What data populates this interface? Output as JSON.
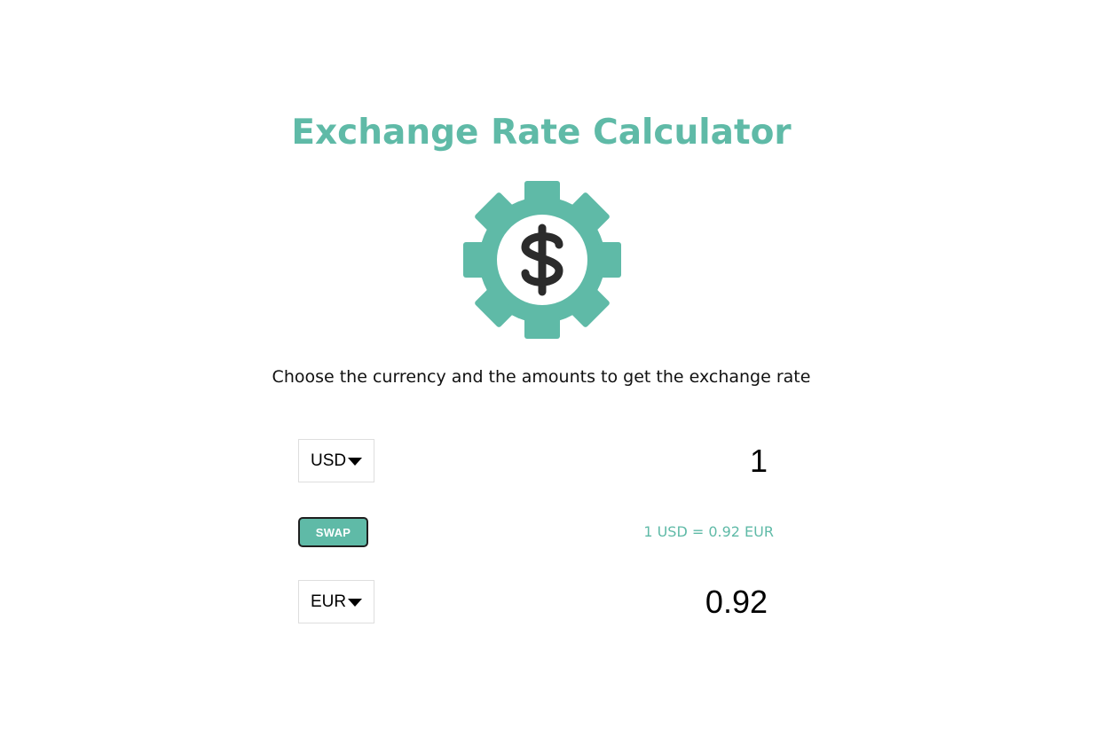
{
  "header": {
    "title": "Exchange Rate Calculator",
    "logo_icon": "gear-dollar-icon"
  },
  "instructions": "Choose the currency and the amounts to get the exchange rate",
  "currency_one": {
    "selected": "USD",
    "amount": "1"
  },
  "swap": {
    "label": "SWAP"
  },
  "rate": {
    "text": "1 USD = 0.92 EUR"
  },
  "currency_two": {
    "selected": "EUR",
    "amount": "0.92"
  },
  "colors": {
    "accent": "#5fbaa7",
    "icon_dark": "#2b2b2b",
    "text": "#111111",
    "border": "#dedede"
  }
}
